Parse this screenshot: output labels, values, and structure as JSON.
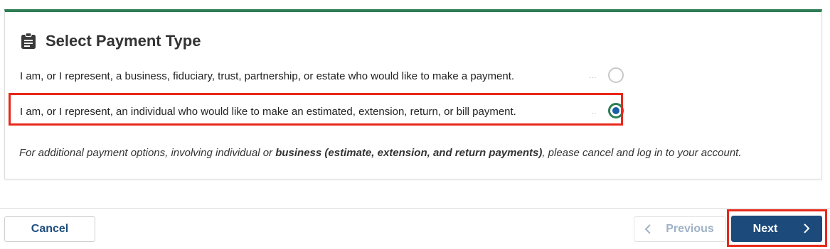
{
  "card": {
    "title": "Select Payment Type",
    "title_icon": "clipboard-icon",
    "accent_color": "#2e7d55"
  },
  "options": [
    {
      "label": "I am, or I represent, a business, fiduciary, trust, partnership, or estate who would like to make a payment.",
      "dots": "...",
      "checked": false
    },
    {
      "label": "I am, or I represent, an individual who would like to make an estimated, extension, return, or bill payment.",
      "dots": "..",
      "checked": true
    }
  ],
  "note": {
    "before": "For additional payment options, involving individual or ",
    "bold": "business (estimate, extension, and return payments)",
    "after": ", please cancel and log in to your account."
  },
  "buttons": {
    "cancel": "Cancel",
    "previous": "Previous",
    "next": "Next",
    "prev_icon": "chevron-left-icon",
    "next_icon": "chevron-right-icon"
  },
  "colors": {
    "primary": "#1c4a7a",
    "highlight": "#e8281a",
    "radio_dot": "#1a5fa8"
  }
}
